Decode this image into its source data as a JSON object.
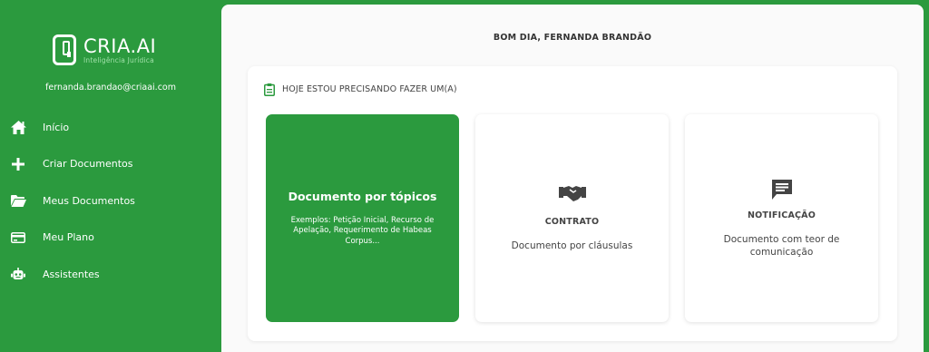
{
  "brand": {
    "name": "CRIA.AI",
    "tagline": "Inteligência Jurídica"
  },
  "user": {
    "email": "fernanda.brandao@criaai.com"
  },
  "sidebar": {
    "items": [
      {
        "label": "Início",
        "icon": "home-icon"
      },
      {
        "label": "Criar Documentos",
        "icon": "plus-icon"
      },
      {
        "label": "Meus Documentos",
        "icon": "folder-icon"
      },
      {
        "label": "Meu Plano",
        "icon": "credit-card-icon"
      },
      {
        "label": "Assistentes",
        "icon": "robot-icon"
      }
    ]
  },
  "main": {
    "greeting": "BOM DIA, FERNANDA BRANDÃO",
    "panel_title": "HOJE ESTOU PRECISANDO FAZER UM(A)",
    "cards": [
      {
        "title": "Documento por tópicos",
        "description": "Exemplos: Petição Inicial, Recurso de Apelação, Requerimento de Habeas Corpus..."
      },
      {
        "title": "CONTRATO",
        "description": "Documento por cláusulas",
        "icon": "handshake-icon"
      },
      {
        "title": "NOTIFICAÇÃO",
        "description": "Documento com teor de comunicação",
        "icon": "message-icon"
      }
    ]
  },
  "colors": {
    "brand_green": "#2b9a3e",
    "background": "#fafafa"
  }
}
